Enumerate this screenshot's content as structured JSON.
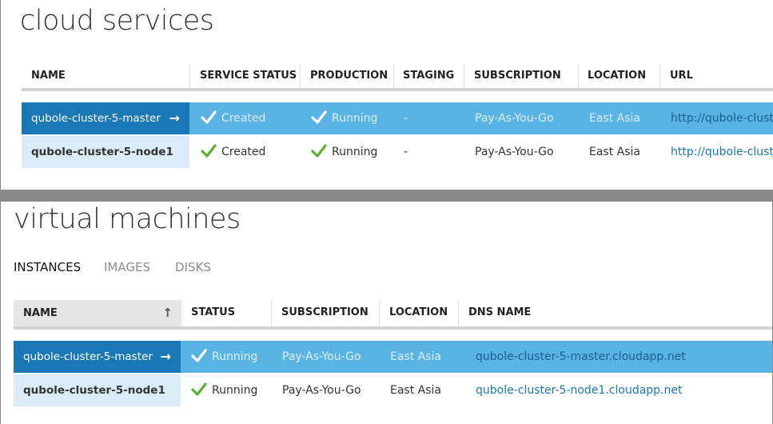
{
  "cloud": {
    "title": "cloud services",
    "columns": [
      "NAME",
      "SERVICE STATUS",
      "PRODUCTION",
      "STAGING",
      "SUBSCRIPTION",
      "LOCATION",
      "URL"
    ],
    "rows": [
      {
        "name": "qubole-cluster-5-master",
        "status": "Created",
        "production": "Running",
        "staging": "-",
        "subscription": "Pay-As-You-Go",
        "location": "East Asia",
        "url": "http://qubole-clust"
      },
      {
        "name": "qubole-cluster-5-node1",
        "status": "Created",
        "production": "Running",
        "staging": "-",
        "subscription": "Pay-As-You-Go",
        "location": "East Asia",
        "url": "http://qubole-clust"
      }
    ]
  },
  "vm": {
    "title": "virtual machines",
    "tabs": [
      "INSTANCES",
      "IMAGES",
      "DISKS"
    ],
    "columns": [
      "NAME",
      "STATUS",
      "SUBSCRIPTION",
      "LOCATION",
      "DNS NAME"
    ],
    "sort_icon": "arrow-up-icon",
    "rows": [
      {
        "name": "qubole-cluster-5-master",
        "status": "Running",
        "subscription": "Pay-As-You-Go",
        "location": "East Asia",
        "dns": "qubole-cluster-5-master.cloudapp.net"
      },
      {
        "name": "qubole-cluster-5-node1",
        "status": "Running",
        "subscription": "Pay-As-You-Go",
        "location": "East Asia",
        "dns": "qubole-cluster-5-node1.cloudapp.net"
      }
    ]
  },
  "colors": {
    "selected_row": "#59b4e3",
    "selected_name": "#1a78b5",
    "name_cell": "#d9ecf8",
    "check_green": "#5bb02e",
    "link": "#1a78b5"
  }
}
